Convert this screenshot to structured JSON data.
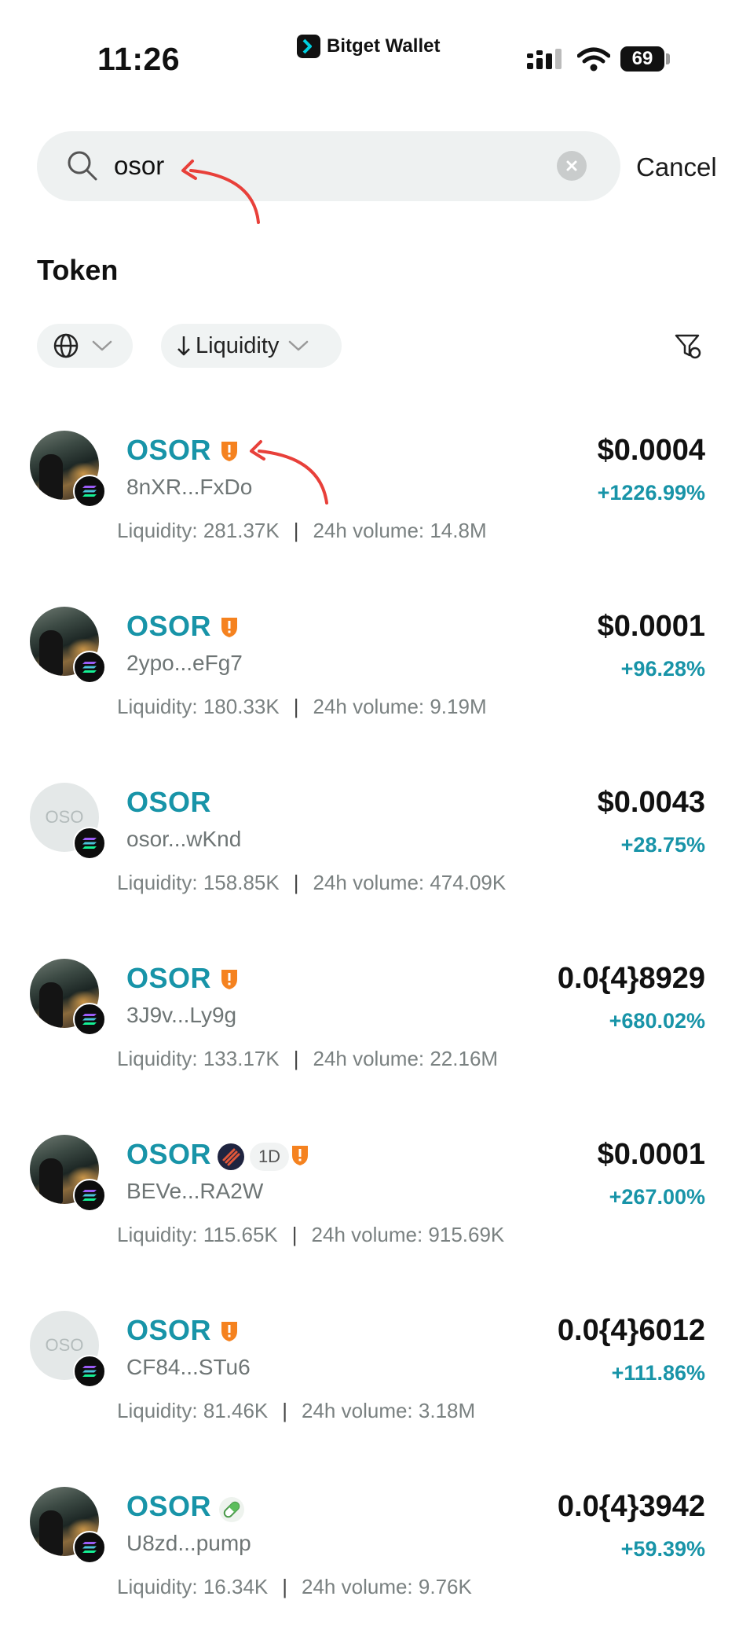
{
  "status_bar": {
    "time": "11:26",
    "app_brand": "Bitget Wallet",
    "battery": "69",
    "icons": [
      "signal-icon",
      "wifi-icon",
      "battery-icon"
    ]
  },
  "search": {
    "value": "osor",
    "placeholder": "",
    "cancel_label": "Cancel",
    "icons": [
      "search-icon",
      "clear-icon"
    ]
  },
  "section": {
    "title": "Token"
  },
  "filters": {
    "network_icon": "globe-icon",
    "sort_label": "Liquidity",
    "sort_icon": "arrow-down-icon",
    "settings_icon": "filter-settings-icon"
  },
  "colors": {
    "accent": "#1894a8",
    "risk_badge": "#f5821f",
    "annotation_arrow": "#e8403a"
  },
  "tokens": [
    {
      "symbol": "OSOR",
      "address": "8nXR...FxDo",
      "liquidity": "Liquidity: 281.37K",
      "volume": "24h volume: 14.8M",
      "price": "$0.0004",
      "change": "+1226.99%",
      "risk_badge": true
    },
    {
      "symbol": "OSOR",
      "address": "2ypo...eFg7",
      "liquidity": "Liquidity: 180.33K",
      "volume": "24h volume: 9.19M",
      "price": "$0.0001",
      "change": "+96.28%",
      "risk_badge": true
    },
    {
      "symbol": "OSOR",
      "address": "osor...wKnd",
      "liquidity": "Liquidity: 158.85K",
      "volume": "24h volume: 474.09K",
      "price": "$0.0043",
      "change": "+28.75%",
      "risk_badge": false,
      "avatar_placeholder": "OSO"
    },
    {
      "symbol": "OSOR",
      "address": "3J9v...Ly9g",
      "liquidity": "Liquidity: 133.17K",
      "volume": "24h volume: 22.16M",
      "price": "0.0{4}8929",
      "change": "+680.02%",
      "risk_badge": true
    },
    {
      "symbol": "OSOR",
      "address": "BEVe...RA2W",
      "liquidity": "Liquidity: 115.65K",
      "volume": "24h volume: 915.69K",
      "price": "$0.0001",
      "change": "+267.00%",
      "risk_badge": true,
      "age_tag": "1D"
    },
    {
      "symbol": "OSOR",
      "address": "CF84...STu6",
      "liquidity": "Liquidity: 81.46K",
      "volume": "24h volume: 3.18M",
      "price": "0.0{4}6012",
      "change": "+111.86%",
      "risk_badge": true,
      "avatar_placeholder": "OSO"
    },
    {
      "symbol": "OSOR",
      "address": "U8zd...pump",
      "liquidity": "Liquidity: 16.34K",
      "volume": "24h volume: 9.76K",
      "price": "0.0{4}3942",
      "change": "+59.39%",
      "risk_badge": false,
      "pill_icon": "pill-icon"
    }
  ]
}
